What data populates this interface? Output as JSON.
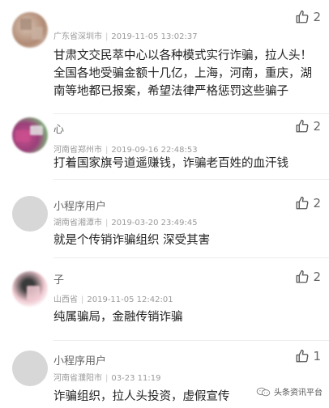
{
  "comments": [
    {
      "name": "",
      "location": "广东省深圳市",
      "time": "2019-11-05 13:02:37",
      "likes": "2",
      "text": "甘肃文交民萃中心以各种模式实行诈骗，拉人头！全国各地受骗金额十几亿，上海，河南，重庆，湖南等地都已报案，希望法律严格惩罚这些骗子"
    },
    {
      "name": "心",
      "location": "河南省郑州市",
      "time": "2019-09-16 22:48:53",
      "likes": "2",
      "text": "打着国家旗号道遥赚钱，诈骗老百姓的血汗钱"
    },
    {
      "name": "小程序用户",
      "location": "湖南省湘潭市",
      "time": "2019-03-20 23:49:45",
      "likes": "2",
      "text": "就是个传销诈骗组织 深受其害"
    },
    {
      "name": "子",
      "location": "山西省",
      "time": "2019-11-05 12:42:01",
      "likes": "2",
      "text": "纯属骗局，金融传销诈骗"
    },
    {
      "name": "小程序用户",
      "location": "河南省濮阳市",
      "time": "03-23 11:19",
      "likes": "1",
      "text": "诈骗组织，拉人头投资，虚假宣传"
    }
  ],
  "watermark": {
    "text": "头条资讯平台",
    "icon": "wechat-icon"
  },
  "icons": {
    "like": "thumbs-up-icon"
  },
  "colors": {
    "text": "#222222",
    "meta": "#9a9a9a",
    "name": "#666666"
  }
}
